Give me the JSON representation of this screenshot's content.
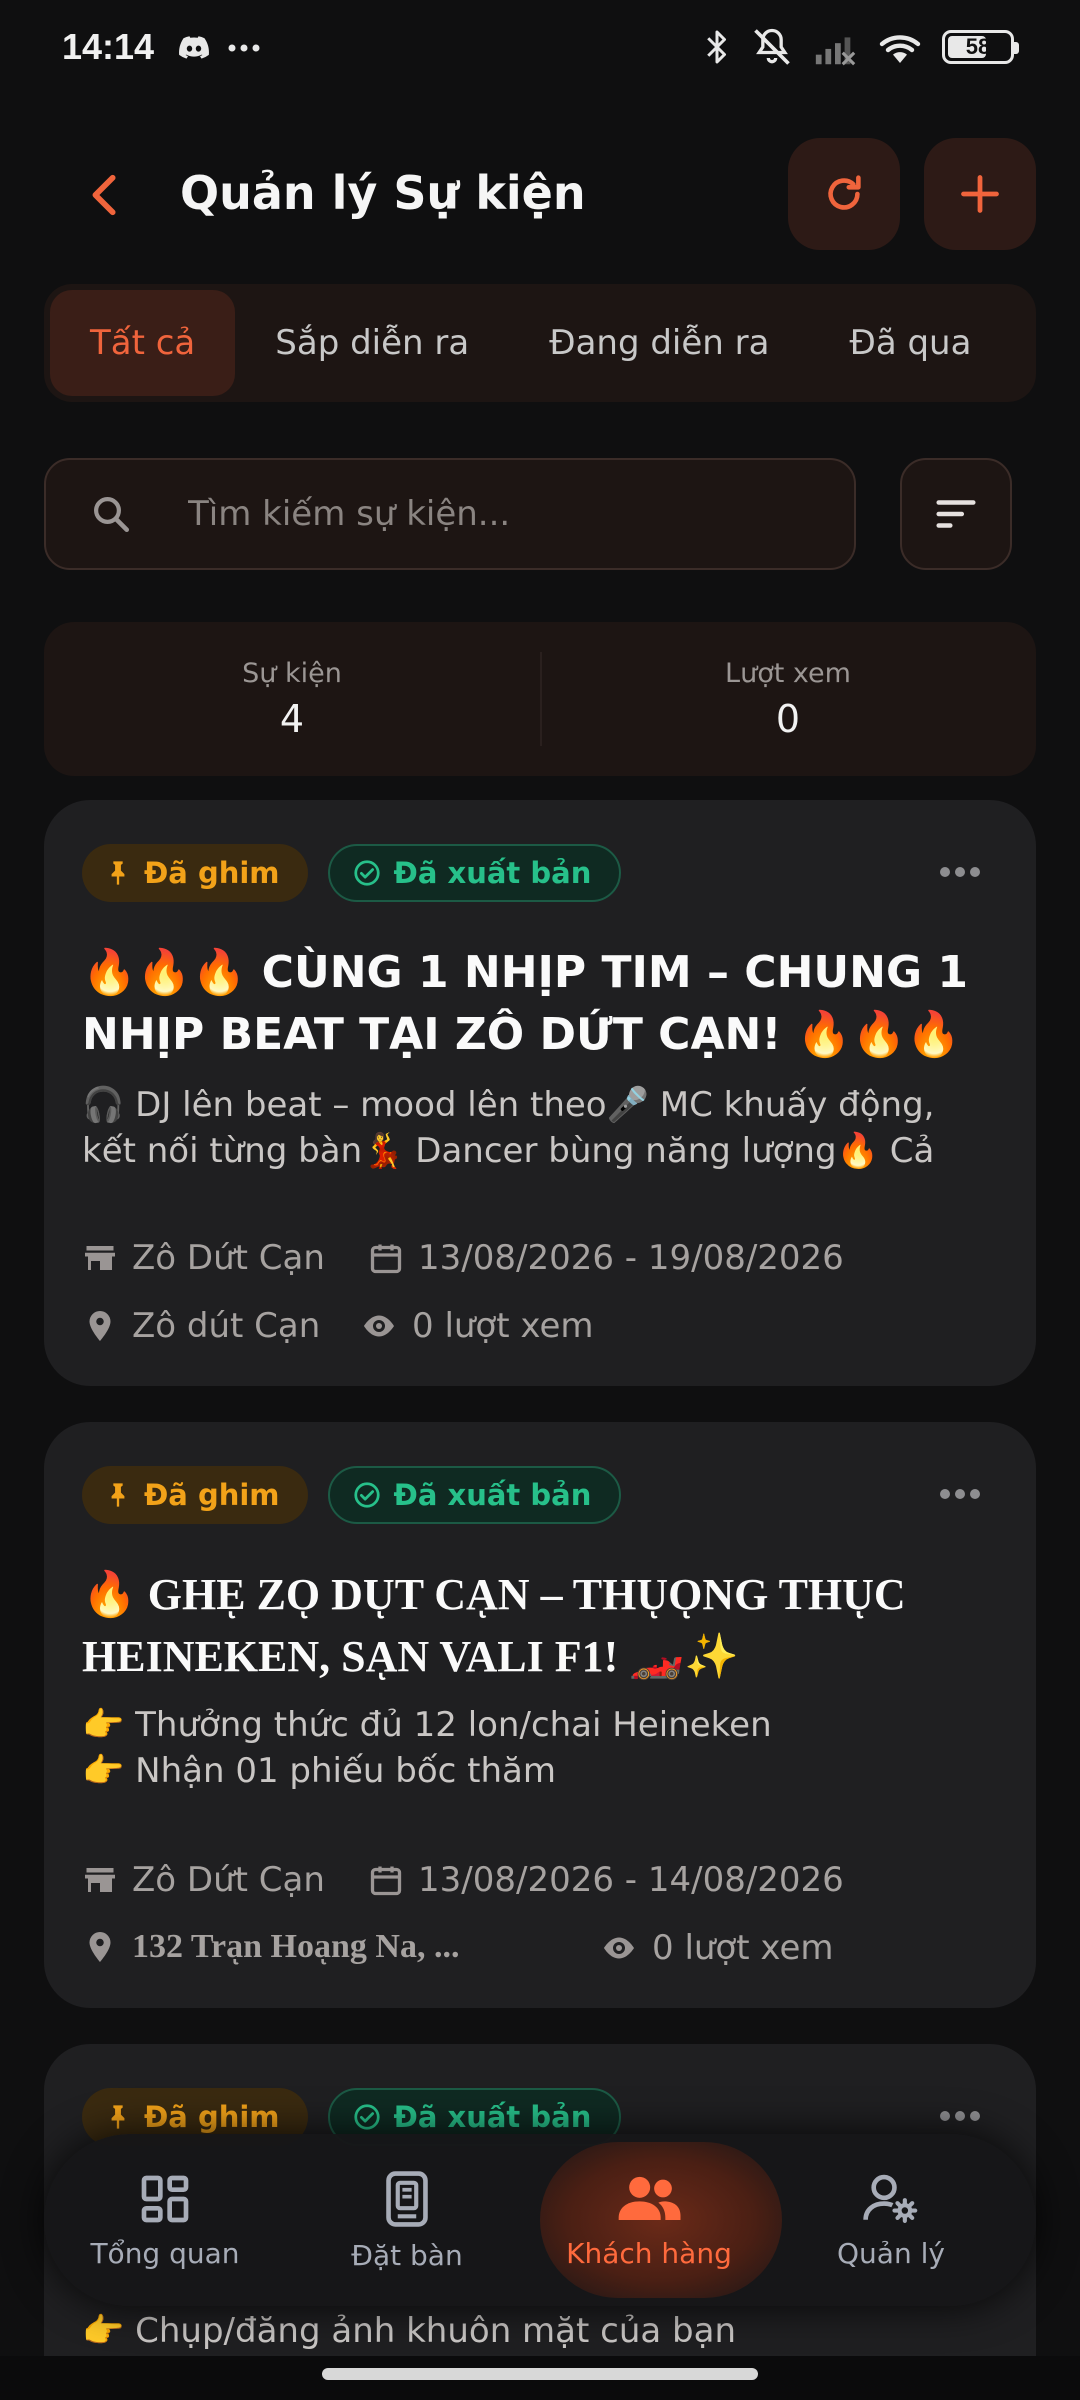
{
  "status_bar": {
    "time": "14:14",
    "battery": "58",
    "battery_level": 0.58,
    "icons": [
      "discord-icon",
      "more-dots-icon",
      "bluetooth-icon",
      "mute-icon",
      "signal-icon",
      "wifi-icon",
      "battery-icon"
    ]
  },
  "header": {
    "title": "Quản lý Sự kiện",
    "accent": "#f0643c"
  },
  "tabs": [
    {
      "label": "Tất cả",
      "active": true
    },
    {
      "label": "Sắp diễn ra",
      "active": false
    },
    {
      "label": "Đang diễn ra",
      "active": false
    },
    {
      "label": "Đã qua",
      "active": false
    }
  ],
  "search": {
    "placeholder": "Tìm kiếm sự kiện..."
  },
  "stats": {
    "events_label": "Sự kiện",
    "events_value": "4",
    "views_label": "Lượt xem",
    "views_value": "0"
  },
  "events": [
    {
      "pinned": "Đã ghim",
      "status": "Đã xuất bản",
      "title": "🔥🔥🔥 CÙNG 1 NHỊP TIM – CHUNG 1 NHỊP BEAT TẠI ZÔ DỨT CẠN! 🔥🔥🔥",
      "description": "🎧 DJ lên beat – mood lên theo🎤 MC khuấy động, kết nối từng bàn💃 Dancer bùng năng lượng🔥 Cả quán...",
      "venue": "Zô Dứt Cạn",
      "dates": "13/08/2026 - 19/08/2026",
      "location": "Zô dút Cạn",
      "views": "0 lượt xem"
    },
    {
      "pinned": "Đã ghim",
      "status": "Đã xuất bản",
      "title": "🔥 GHEͅ ZOͅ DUͅͅT CAͅN – THUͅOͅͅNG THUͅͅC HEINEKEN, SAͅN VALI F1! 🏎️✨",
      "description": "👉 Thưởng thức đủ 12 lon/chai Heineken\n👉 Nhận 01 phiếu bốc thăm",
      "venue": "Zô Dứt Cạn",
      "dates": "13/08/2026 - 14/08/2026",
      "location": "132 Traͅͅn Hoaͅng Na, ...",
      "views": "0 lượt xem"
    },
    {
      "pinned": "Đã ghim",
      "status": "Đã xuất bản",
      "description_line": "👉 Chụp/đăng ảnh khuôn mặt của bạn"
    }
  ],
  "bottom_nav": [
    {
      "label": "Tổng quan",
      "icon": "dashboard-icon",
      "active": false
    },
    {
      "label": "Đặt bàn",
      "icon": "booking-icon",
      "active": false
    },
    {
      "label": "Khách hàng",
      "icon": "customers-icon",
      "active": true
    },
    {
      "label": "Quản lý",
      "icon": "manage-user-settings-icon",
      "active": false
    }
  ]
}
